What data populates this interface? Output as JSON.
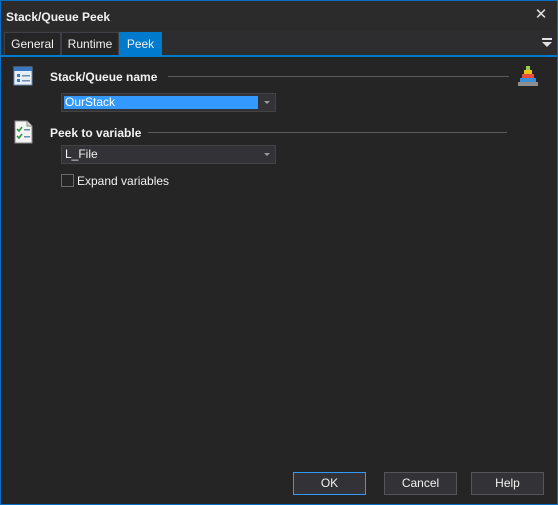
{
  "window": {
    "title": "Stack/Queue Peek",
    "close_glyph": "✕"
  },
  "tabs": [
    {
      "label": "General",
      "active": false
    },
    {
      "label": "Runtime",
      "active": false
    },
    {
      "label": "Peek",
      "active": true
    }
  ],
  "section_name": {
    "label": "Stack/Queue name",
    "icon": "form-icon",
    "value": "OurStack",
    "side_icon": "stack-pyramid-icon"
  },
  "section_peek": {
    "label": "Peek to variable",
    "icon": "checklist-icon",
    "value": "L_File",
    "expand_label": "Expand variables",
    "expand_checked": false
  },
  "buttons": {
    "ok": "OK",
    "cancel": "Cancel",
    "help": "Help"
  },
  "colors": {
    "accent": "#007acc",
    "selection": "#3399ff",
    "background": "#252526"
  }
}
